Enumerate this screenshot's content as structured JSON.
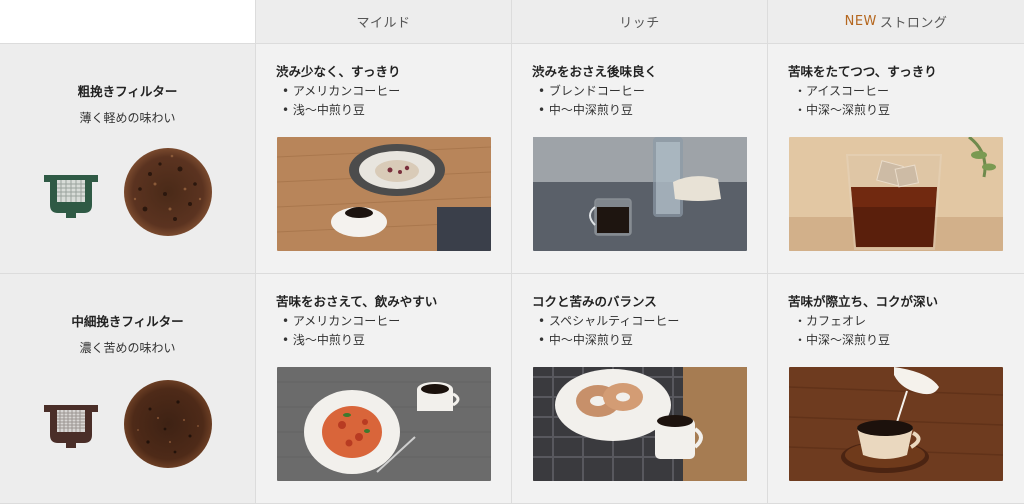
{
  "columns": {
    "mild": "マイルド",
    "rich": "リッチ",
    "strong_new": "NEW",
    "strong": "ストロング"
  },
  "rows": [
    {
      "filter_name": "粗挽きフィルター",
      "taste": "薄く軽めの味わい",
      "filter_icon": "coarse-filter-icon",
      "filter_color": "#2f5a45"
    },
    {
      "filter_name": "中細挽きフィルター",
      "taste": "濃く苦めの味わい",
      "filter_icon": "medium-fine-filter-icon",
      "filter_color": "#4a2e28"
    }
  ],
  "cells": {
    "r1_mild": {
      "title": "渋み少なく、すっきり",
      "items": [
        "アメリカンコーヒー",
        "浅〜中煎り豆"
      ],
      "bullet": "•"
    },
    "r1_rich": {
      "title": "渋みをおさえ後味良く",
      "items": [
        "ブレンドコーヒー",
        "中〜中深煎り豆"
      ],
      "bullet": "•"
    },
    "r1_strong": {
      "title": "苦味をたてつつ、すっきり",
      "items": [
        "アイスコーヒー",
        "中深〜深煎り豆"
      ],
      "bullet": "・"
    },
    "r2_mild": {
      "title": "苦味をおさえて、飲みやすい",
      "items": [
        "アメリカンコーヒー",
        "浅〜中煎り豆"
      ],
      "bullet": "•"
    },
    "r2_rich": {
      "title": "コクと苦みのバランス",
      "items": [
        "スペシャルティコーヒー",
        "中〜中深煎り豆"
      ],
      "bullet": "•"
    },
    "r2_strong": {
      "title": "苦味が際立ち、コクが深い",
      "items": [
        "カフェオレ",
        "中深〜深煎り豆"
      ],
      "bullet": "・"
    }
  }
}
